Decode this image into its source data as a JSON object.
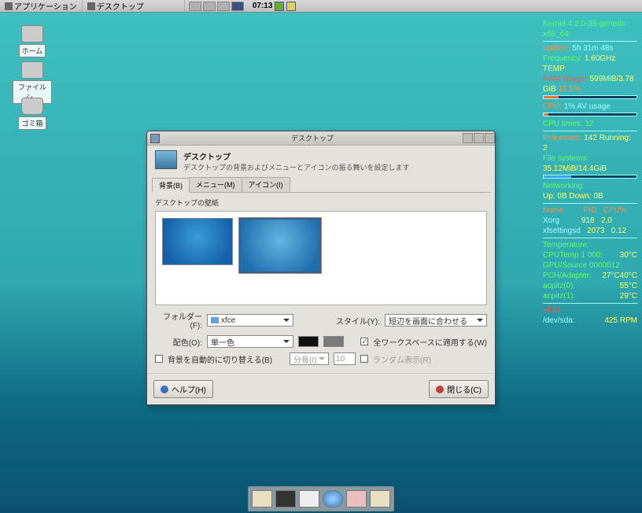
{
  "panel": {
    "app_menu": "アプリケーション",
    "active_window": "デスクトップ",
    "clock": "07:13"
  },
  "desktop_icons": {
    "home": "ホーム",
    "filesystem": "ファイルシ...",
    "trash": "ゴミ箱"
  },
  "dialog": {
    "title": "デスクトップ",
    "header_title": "デスクトップ",
    "header_sub": "デスクトップの背景およびメニューとアイコンの振る舞いを設定します",
    "tabs": {
      "bg": "背景(B)",
      "menu": "メニュー(M)",
      "icon": "アイコン(I)"
    },
    "section": "デスクトップの壁紙",
    "folder_label": "フォルダー(F):",
    "folder_value": "xfce",
    "style_label": "スタイル(Y):",
    "style_value": "短辺を画面に合わせる",
    "color_label": "配色(O):",
    "color_value": "単一色",
    "apply_all": "全ワークスペースに適用する(W)",
    "auto_label": "背景を自動的に切り替える(B)",
    "interval_unit": "分毎(I)",
    "interval_val": "10",
    "random": "ランダム表示(R)",
    "help": "ヘルプ(H)",
    "close": "閉じる(C)",
    "swatch1": "#111111",
    "swatch2": "#7a7a7a"
  },
  "conky": {
    "kernel": "Kernel 4.2.0-35-generic x86_64",
    "uptime_l": "Uptime:",
    "uptime_v": "5h 31m 48s",
    "freq_l": "Frequency:",
    "freq_v": "1.60GHz  TEMP",
    "ram_l": "RAM Usage:",
    "ram_frac": "599MiB/3.78 GiB",
    "ram_pct": "15.5%",
    "cpu_l": "CPU:",
    "cpu_v": "1%  AV usage",
    "bar1": 5,
    "cpu_times": "CPU times:  12",
    "proc_l": "Processes:",
    "proc_v": "142  Running:  2",
    "fs_l": "File systems:",
    "fs_root": "35.12MiB/14.4GiB",
    "bar2": 30,
    "net_l": "Networking:",
    "net_up": " Up:  0B    Down:  0B",
    "name_l": "Name",
    "pid_l": "PID",
    "cpu_h": "CPU%",
    "p1n": "Xorg",
    "p1p": "918",
    "p1c": "2.0",
    "p2n": "xfsettingsd",
    "p2p": "2073",
    "p2c": "0.12",
    "temp_l": "Temperature:",
    "t1": "CPUTemp 1 000:",
    "t1v": "30°C",
    "t2": "GPU/Source 0000012:",
    "t2v": "40°C",
    "t3": "PCH/Adapter:",
    "t3v": "27°C",
    "t4": "acpitz(0):",
    "t4v": "55°C",
    "t5": "acpitz(1):",
    "t5v": "29°C",
    "hdd_l": "HDD",
    "hdd_dev": "/dev/sda:",
    "hdd_rpm": "425 RPM"
  }
}
